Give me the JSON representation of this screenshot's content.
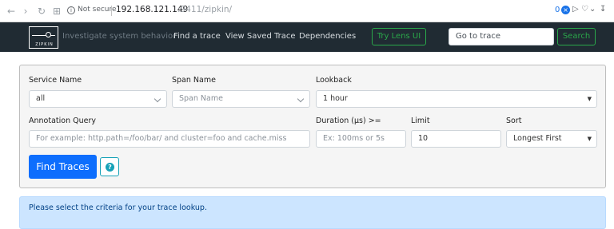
{
  "browser": {
    "security_label": "Not secure",
    "url_host": "192.168.121.149",
    "url_path": ":9411/zipkin/",
    "extension_count": "0"
  },
  "navbar": {
    "logo_text": "ZIPKIN",
    "tagline": "Investigate system behavior",
    "links": [
      "Find a trace",
      "View Saved Trace",
      "Dependencies"
    ],
    "lens_button": "Try Lens UI",
    "goto_placeholder": "Go to trace",
    "search_button": "Search"
  },
  "form": {
    "service_name": {
      "label": "Service Name",
      "value": "all"
    },
    "span_name": {
      "label": "Span Name",
      "placeholder": "Span Name"
    },
    "lookback": {
      "label": "Lookback",
      "value": "1 hour"
    },
    "annotation_query": {
      "label": "Annotation Query",
      "placeholder": "For example: http.path=/foo/bar/ and cluster=foo and cache.miss"
    },
    "duration": {
      "label": "Duration (μs) >=",
      "placeholder": "Ex: 100ms or 5s"
    },
    "limit": {
      "label": "Limit",
      "value": "10"
    },
    "sort": {
      "label": "Sort",
      "value": "Longest First"
    },
    "find_button": "Find Traces",
    "help_symbol": "?"
  },
  "alert": {
    "message": "Please select the criteria for your trace lookup."
  },
  "colors": {
    "navbar_bg": "#202b33",
    "accent_green": "#2aa84a",
    "primary_blue": "#0d6efd",
    "info_bg": "#cce5ff",
    "info_text": "#004085"
  }
}
